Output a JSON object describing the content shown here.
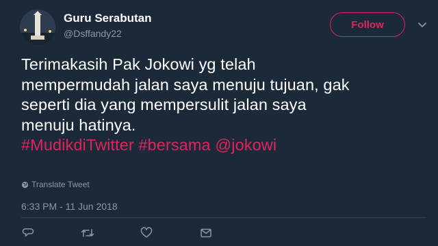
{
  "user": {
    "name": "Guru Serabutan",
    "handle": "@Dsffandy22"
  },
  "follow_label": "Follow",
  "tweet": {
    "lines": [
      "Terimakasih Pak Jokowi yg telah",
      "mempermudah jalan saya menuju tujuan, gak",
      "seperti dia yang mempersulit jalan saya",
      "menuju hatinya."
    ],
    "hashtags": [
      "#MudikdiTwitter",
      "#bersama",
      "@jokowi"
    ]
  },
  "translate_label": "Translate Tweet",
  "timestamp": "6:33 PM - 11 Jun 2018",
  "colors": {
    "background": "#1c2938",
    "accent": "#e0245e",
    "muted": "#8899a6"
  },
  "icons": [
    "chevron-down-icon",
    "globe-icon",
    "reply-icon",
    "retweet-icon",
    "like-icon",
    "message-icon"
  ]
}
